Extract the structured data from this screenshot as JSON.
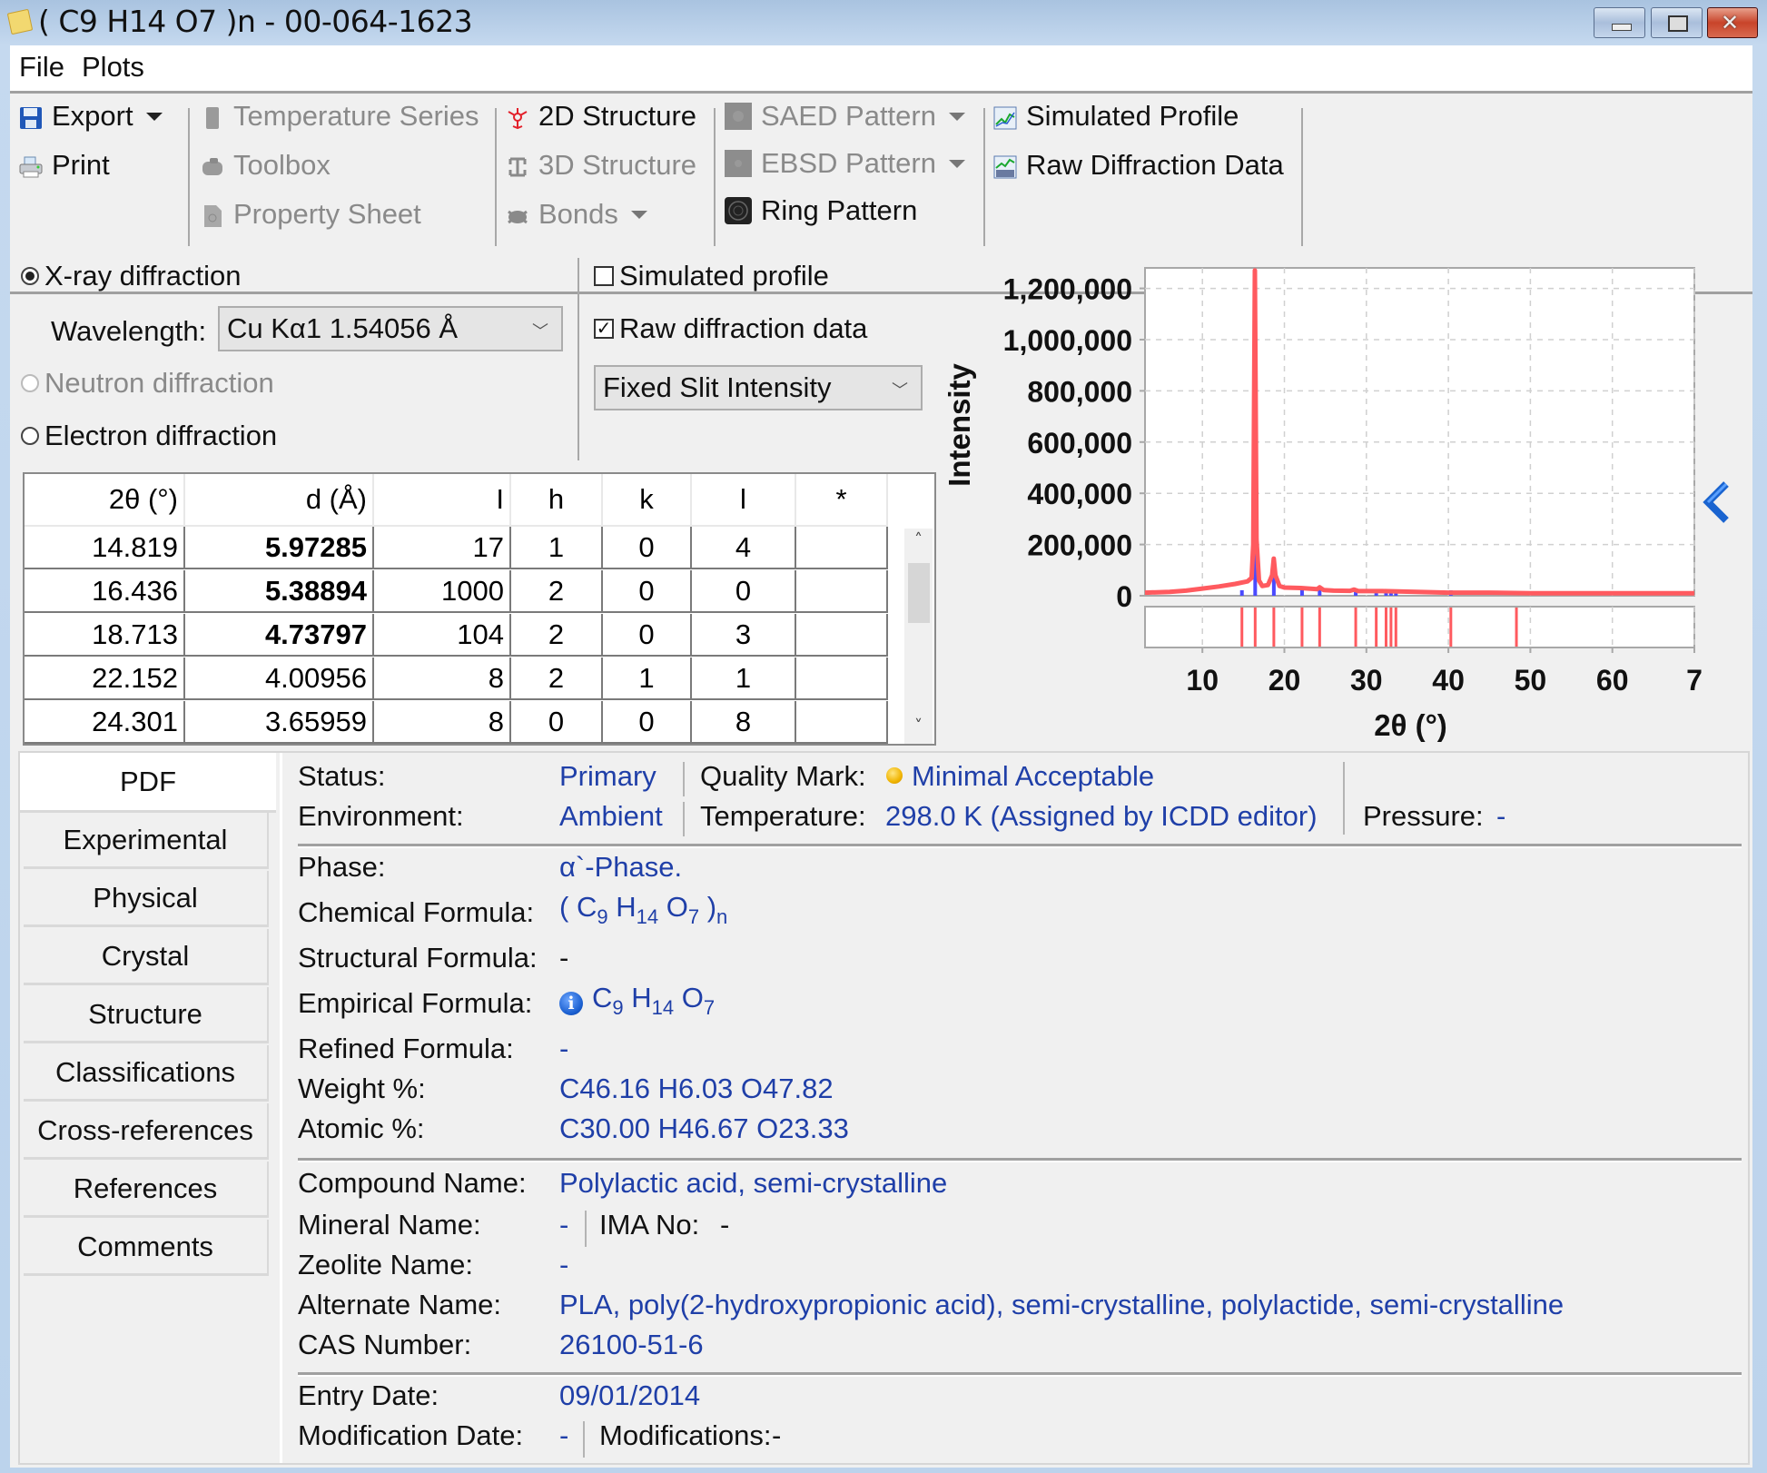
{
  "window": {
    "title": "( C9 H14 O7 )n - 00-064-1623",
    "buttons": {
      "minimize": "minimize",
      "maximize": "maximize",
      "close": "close"
    }
  },
  "menu": {
    "items": [
      "File",
      "Plots"
    ]
  },
  "toolbar": {
    "export": {
      "label": "Export",
      "icon": "floppy-disk-icon",
      "enabled": true
    },
    "print": {
      "label": "Print",
      "icon": "printer-icon",
      "enabled": true
    },
    "temperature_series": {
      "label": "Temperature Series",
      "icon": "thermometer-icon",
      "enabled": false
    },
    "toolbox": {
      "label": "Toolbox",
      "icon": "toolbox-icon",
      "enabled": false
    },
    "property_sheet": {
      "label": "Property Sheet",
      "icon": "sheet-icon",
      "enabled": false
    },
    "structure_2d": {
      "label": "2D Structure",
      "icon": "molecule-2d-icon",
      "enabled": true
    },
    "structure_3d": {
      "label": "3D Structure",
      "icon": "molecule-3d-icon",
      "enabled": false
    },
    "bonds": {
      "label": "Bonds",
      "icon": "bonds-icon",
      "enabled": false
    },
    "saed_pattern": {
      "label": "SAED Pattern",
      "icon": "saed-icon",
      "enabled": false
    },
    "ebsd_pattern": {
      "label": "EBSD Pattern",
      "icon": "ebsd-icon",
      "enabled": false
    },
    "ring_pattern": {
      "label": "Ring Pattern",
      "icon": "ring-pattern-icon",
      "enabled": true
    },
    "simulated_profile": {
      "label": "Simulated Profile",
      "icon": "profile-chart-icon",
      "enabled": true
    },
    "raw_diffraction_data": {
      "label": "Raw Diffraction Data",
      "icon": "raw-data-chart-icon",
      "enabled": true
    }
  },
  "options": {
    "xray": {
      "label": "X-ray diffraction",
      "selected": true
    },
    "wavelength_label": "Wavelength:",
    "wavelength_value": "Cu Kα1 1.54056 Å",
    "neutron": {
      "label": "Neutron diffraction",
      "selected": false,
      "enabled": false
    },
    "electron": {
      "label": "Electron diffraction",
      "selected": false
    },
    "simulated_profile": {
      "label": "Simulated profile",
      "checked": false
    },
    "raw_diffraction": {
      "label": "Raw diffraction data",
      "checked": true
    },
    "intensity_mode": "Fixed Slit Intensity"
  },
  "peak_table": {
    "columns": [
      "2θ (°)",
      "d (Å)",
      "I",
      "h",
      "k",
      "l",
      "*"
    ],
    "rows": [
      {
        "two_theta": "14.819",
        "d": "5.97285",
        "d_bold": true,
        "I": "17",
        "h": "1",
        "k": "0",
        "l": "4",
        "star": ""
      },
      {
        "two_theta": "16.436",
        "d": "5.38894",
        "d_bold": true,
        "I": "1000",
        "h": "2",
        "k": "0",
        "l": "0",
        "star": ""
      },
      {
        "two_theta": "18.713",
        "d": "4.73797",
        "d_bold": true,
        "I": "104",
        "h": "2",
        "k": "0",
        "l": "3",
        "star": ""
      },
      {
        "two_theta": "22.152",
        "d": "4.00956",
        "d_bold": false,
        "I": "8",
        "h": "2",
        "k": "1",
        "l": "1",
        "star": ""
      },
      {
        "two_theta": "24.301",
        "d": "3.65959",
        "d_bold": false,
        "I": "8",
        "h": "0",
        "k": "0",
        "l": "8",
        "star": ""
      }
    ]
  },
  "chart_data": {
    "type": "line",
    "title": "",
    "xlabel": "2θ (°)",
    "ylabel": "Intensity",
    "xlim": [
      3,
      70
    ],
    "ylim": [
      0,
      1280000
    ],
    "x_ticks": [
      10,
      20,
      30,
      40,
      50,
      60,
      70
    ],
    "x_tick_labels": [
      "10",
      "20",
      "30",
      "40",
      "50",
      "60",
      "7"
    ],
    "y_ticks": [
      0,
      200000,
      400000,
      600000,
      800000,
      1000000,
      1200000
    ],
    "y_tick_labels": [
      "0",
      "200,000",
      "400,000",
      "600,000",
      "800,000",
      "1,000,000",
      "1,200,000"
    ],
    "grid": true,
    "series": [
      {
        "name": "Raw diffraction data",
        "color": "#ff5a5f",
        "x": [
          3,
          6,
          8,
          10,
          12,
          14,
          15.5,
          16.0,
          16.2,
          16.4,
          16.6,
          16.9,
          17.3,
          18.0,
          18.5,
          18.7,
          18.9,
          19.4,
          20,
          22,
          24,
          24.3,
          24.8,
          26,
          28,
          28.5,
          29,
          32,
          35,
          40,
          45,
          50,
          55,
          60,
          65,
          70
        ],
        "y": [
          12000,
          15000,
          20000,
          28000,
          36000,
          46000,
          56000,
          70000,
          200000,
          1270000,
          220000,
          60000,
          38000,
          42000,
          80000,
          145000,
          80000,
          38000,
          32000,
          30000,
          26000,
          33000,
          22000,
          20000,
          19000,
          24000,
          18000,
          18000,
          16000,
          12000,
          12000,
          10000,
          10000,
          10000,
          10000,
          10000
        ]
      },
      {
        "name": "Reference peak sticks (overlay)",
        "color": "#4a4aff",
        "x": [
          14.819,
          16.436,
          18.713,
          22.152,
          24.301,
          28.7,
          31.2,
          32.4,
          33.0,
          33.6,
          40.3
        ],
        "relative_intensity": [
          17,
          1000,
          104,
          8,
          8,
          3,
          3,
          4,
          4,
          4,
          2
        ]
      }
    ],
    "stick_panel": {
      "color": "#ff5a5f",
      "positions": [
        14.819,
        16.436,
        18.713,
        22.152,
        24.301,
        28.7,
        31.2,
        32.4,
        33.0,
        33.6,
        40.3,
        48.3
      ]
    }
  },
  "side_panel_toggle": "collapse-arrow",
  "tabs": [
    "PDF",
    "Experimental",
    "Physical",
    "Crystal",
    "Structure",
    "Classifications",
    "Cross-references",
    "References",
    "Comments"
  ],
  "active_tab": "PDF",
  "pdf": {
    "status_label": "Status:",
    "status_value": "Primary",
    "quality_label": "Quality Mark:",
    "quality_value": "Minimal Acceptable",
    "quality_color": "#f0b400",
    "environment_label": "Environment:",
    "environment_value": "Ambient",
    "temperature_label": "Temperature:",
    "temperature_value": "298.0 K (Assigned by ICDD editor)",
    "pressure_label": "Pressure:",
    "pressure_value": "-",
    "phase_label": "Phase:",
    "phase_value": "α`-Phase.",
    "chemical_formula_label": "Chemical Formula:",
    "chemical_formula": {
      "open": "( ",
      "parts": [
        {
          "el": "C",
          "n": "9"
        },
        {
          "el": "H",
          "n": "14"
        },
        {
          "el": "O",
          "n": "7"
        }
      ],
      "close": " )",
      "close_sub": "n"
    },
    "structural_formula_label": "Structural Formula:",
    "structural_formula_value": "-",
    "empirical_formula_label": "Empirical Formula:",
    "empirical_formula": {
      "parts": [
        {
          "el": "C",
          "n": "9"
        },
        {
          "el": "H",
          "n": "14"
        },
        {
          "el": "O",
          "n": "7"
        }
      ]
    },
    "refined_formula_label": "Refined Formula:",
    "refined_formula_value": "-",
    "weight_label": "Weight %:",
    "weight_value": "C46.16 H6.03 O47.82",
    "atomic_label": "Atomic %:",
    "atomic_value": "C30.00 H46.67 O23.33",
    "compound_label": "Compound Name:",
    "compound_value": "Polylactic acid, semi-crystalline",
    "mineral_label": "Mineral Name:",
    "mineral_value": "-",
    "ima_label": "IMA No:",
    "ima_value": "-",
    "zeolite_label": "Zeolite Name:",
    "zeolite_value": "-",
    "alternate_label": "Alternate Name:",
    "alternate_value": "PLA, poly(2-hydroxypropionic acid), semi-crystalline, polylactide, semi-crystalline",
    "cas_label": "CAS Number:",
    "cas_value": "26100-51-6",
    "entry_date_label": "Entry Date:",
    "entry_date_value": "09/01/2014",
    "mod_date_label": "Modification Date:",
    "mod_date_value": "-",
    "modifications_label": "Modifications:",
    "modifications_value": "-"
  }
}
